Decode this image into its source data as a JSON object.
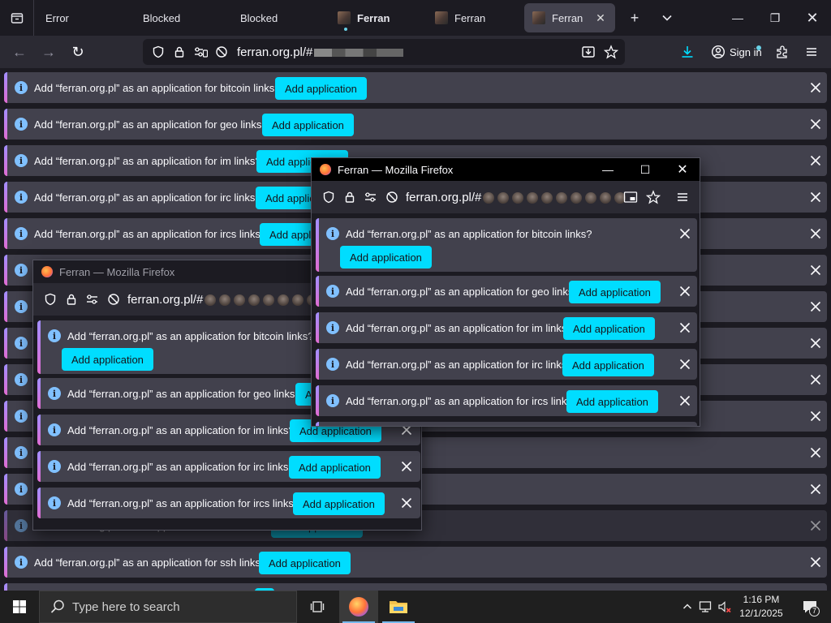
{
  "browser": {
    "tabs": [
      {
        "title": "Error",
        "active": false,
        "favicon": false
      },
      {
        "title": "Blocked",
        "active": false,
        "favicon": false
      },
      {
        "title": "Blocked",
        "active": false,
        "favicon": false
      },
      {
        "title": "Ferran",
        "active": false,
        "favicon": true,
        "bold": true,
        "playing": true
      },
      {
        "title": "Ferran",
        "active": false,
        "favicon": true
      },
      {
        "title": "Ferran",
        "active": true,
        "favicon": true,
        "closable": true
      }
    ],
    "url": "ferran.org.pl/#",
    "sign_in_label": "Sign in"
  },
  "notifications": [
    {
      "msg": "Add “ferran.org.pl” as an application for bitcoin links?",
      "btn": "Add application"
    },
    {
      "msg": "Add “ferran.org.pl” as an application for geo links?",
      "btn": "Add application"
    },
    {
      "msg": "Add “ferran.org.pl” as an application for im links?",
      "btn": "Add application"
    },
    {
      "msg": "Add “ferran.org.pl” as an application for irc links?",
      "btn": "Add application"
    },
    {
      "msg": "Add “ferran.org.pl” as an application for ircs links?",
      "btn": "Add application"
    },
    {
      "msg": "Add “ferran.org.pl” as an application for smsto links?",
      "btn": "Add application"
    },
    {
      "msg": "Add “ferran.org.pl” as an application for ssh links?",
      "btn": "Add application"
    }
  ],
  "popup_large": {
    "title": "Ferran — Mozilla Firefox",
    "url": "ferran.org.pl/#",
    "notifications": [
      {
        "msg": "Add “ferran.org.pl” as an application for bitcoin links?",
        "btn": "Add application"
      },
      {
        "msg": "Add “ferran.org.pl” as an application for geo links?",
        "btn": "Add application"
      },
      {
        "msg": "Add “ferran.org.pl” as an application for im links?",
        "btn": "Add application"
      },
      {
        "msg": "Add “ferran.org.pl” as an application for irc links?",
        "btn": "Add application"
      },
      {
        "msg": "Add “ferran.org.pl” as an application for ircs links?",
        "btn": "Add application"
      }
    ]
  },
  "popup_small": {
    "title": "Ferran — Mozilla Firefox",
    "url": "ferran.org.pl/#",
    "notifications": [
      {
        "msg": "Add “ferran.org.pl” as an application for bitcoin links?",
        "btn": "Add application"
      },
      {
        "msg": "Add “ferran.org.pl” as an application for geo links?",
        "btn": "Add application"
      },
      {
        "msg": "Add “ferran.org.pl” as an application for im links?",
        "btn": "Add application"
      },
      {
        "msg": "Add “ferran.org.pl” as an application for irc links?",
        "btn": "Add application"
      },
      {
        "msg": "Add “ferran.org.pl” as an application for ircs links?",
        "btn": "Add application"
      }
    ]
  },
  "taskbar": {
    "search_placeholder": "Type here to search",
    "time": "1:16 PM",
    "date": "12/1/2025",
    "notification_count": "7"
  },
  "colors": {
    "accent_button": "#00ddff",
    "notification_bg": "#42414d",
    "toolbar_bg": "#2b2a33",
    "window_bg": "#1c1b22"
  },
  "icons": [
    "tab-list-icon",
    "back-icon",
    "forward-icon",
    "reload-icon",
    "shield-icon",
    "lock-icon",
    "permissions-icon",
    "tracking-off-icon",
    "save-page-icon",
    "bookmark-star-icon",
    "downloads-icon",
    "account-icon",
    "extensions-icon",
    "menu-icon",
    "info-icon",
    "close-icon",
    "windows-start-icon",
    "search-icon",
    "task-view-icon",
    "firefox-icon",
    "file-explorer-icon",
    "chevron-up-icon",
    "network-icon",
    "volume-icon",
    "notification-icon"
  ]
}
